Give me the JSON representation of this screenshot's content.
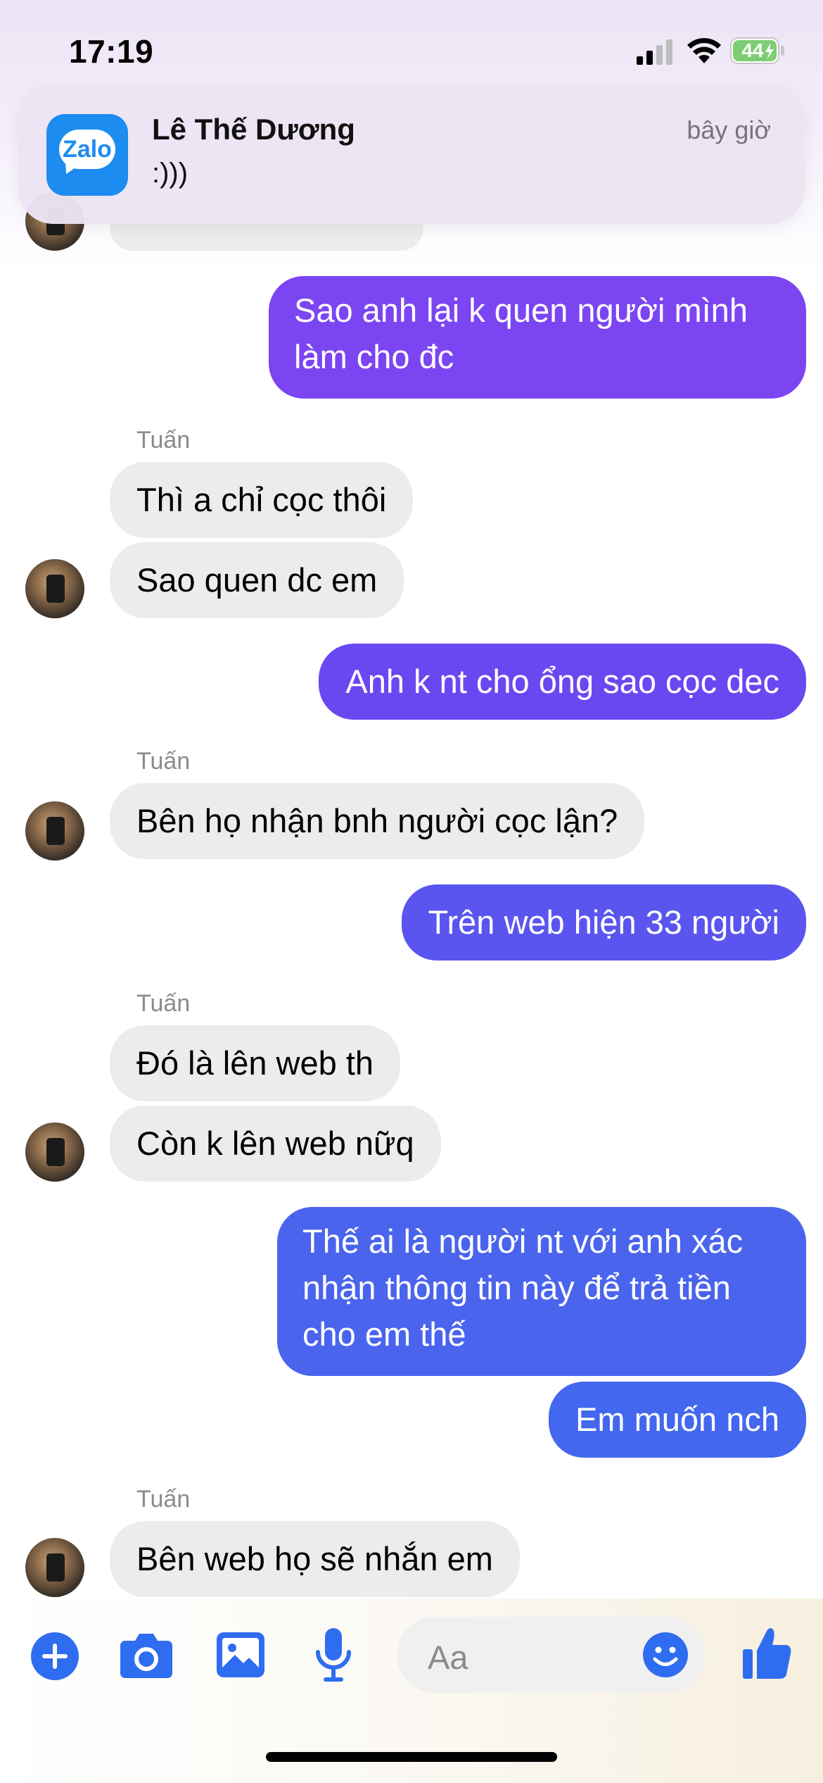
{
  "status_bar": {
    "time": "17:19",
    "battery_level": "44"
  },
  "notification": {
    "app_icon_text": "Zalo",
    "title": "Lê Thế Dương",
    "body": ":)))",
    "time": "bây giờ"
  },
  "messages": {
    "m1": "Sao anh lại k quen người mình làm cho đc",
    "sender1": "Tuấn",
    "m2": "Thì a chỉ cọc thôi",
    "m3": "Sao quen dc em",
    "m4": "Anh k nt cho ổng sao cọc dec",
    "sender2": "Tuấn",
    "m5": "Bên họ nhận bnh người cọc lận?",
    "m6": "Trên web hiện 33 người",
    "sender3": "Tuấn",
    "m7": "Đó là lên web th",
    "m8": "Còn k lên web nữq",
    "m9": "Thế ai là người nt với anh xác nhận thông tin này để trả tiền cho em thế",
    "m10": "Em muốn nch",
    "sender4": "Tuấn",
    "m11": "Bên web họ sẽ nhắn em"
  },
  "composer": {
    "placeholder": "Aa"
  },
  "colors": {
    "outgoing_purple": "#7b45f2",
    "outgoing_violet": "#6648f0",
    "outgoing_blue": "#4566ee",
    "incoming_gray": "#ececec",
    "messenger_blue": "#2f6df0"
  }
}
